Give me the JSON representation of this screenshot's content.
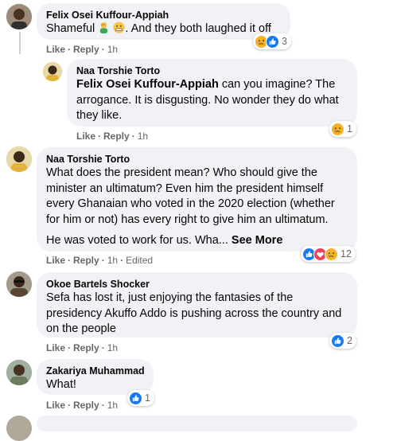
{
  "comments": [
    {
      "author": "Felix Osei Kuffour-Appiah",
      "text_before": "Shameful",
      "text_after": ". And they both laughed it off",
      "emojis": [
        "person-facepalm-icon",
        "grimacing-face-icon"
      ],
      "reaction_count": "3",
      "reactions": [
        "sad-reaction-icon",
        "like-reaction-icon"
      ],
      "like": "Like",
      "reply": "Reply",
      "time": "1h"
    },
    {
      "author": "Naa Torshie Torto",
      "mention": "Felix Osei Kuffour-Appiah",
      "text": " can you imagine? The arrogance. It is disgusting. No wonder they do what they like.",
      "reaction_count": "1",
      "reactions": [
        "sad-reaction-icon"
      ],
      "like": "Like",
      "reply": "Reply",
      "time": "1h"
    },
    {
      "author": "Naa Torshie Torto",
      "text": "What does the president mean? Who should give the minister an ultimatum? Even him the president himself every Ghanaian who voted in the 2020 election (whether for him or not) has every right to give him an ultimatum.",
      "text2": "He was voted to work for us. Wha...",
      "see_more": "See More",
      "reaction_count": "12",
      "reactions": [
        "like-reaction-icon",
        "love-reaction-icon",
        "sad-reaction-icon"
      ],
      "like": "Like",
      "reply": "Reply",
      "time": "1h",
      "edited": "Edited"
    },
    {
      "author": "Okoe Bartels Shocker",
      "text": "Sefa has lost it, just enjoying the fantasies of the presidency Akuffo Addo is pushing across the country and on the people",
      "reaction_count": "2",
      "reactions": [
        "like-reaction-icon"
      ],
      "like": "Like",
      "reply": "Reply",
      "time": "1h"
    },
    {
      "author": "Zakariya Muhammad",
      "text": "What!",
      "reaction_count": "1",
      "reactions": [
        "like-reaction-icon"
      ],
      "like": "Like",
      "reply": "Reply",
      "time": "1h"
    }
  ],
  "colors": {
    "bubble": "#f0f2f5",
    "meta_text": "#65676b",
    "like_blue": "#1877f2",
    "love_red": "#f33e58",
    "sad_yellow": "#f7b125"
  }
}
